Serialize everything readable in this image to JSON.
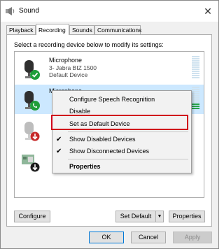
{
  "window": {
    "title": "Sound",
    "close_glyph": "✕"
  },
  "tabs": [
    "Playback",
    "Recording",
    "Sounds",
    "Communications"
  ],
  "instructions": "Select a recording device below to modify its settings:",
  "devices": [
    {
      "name": "Microphone",
      "desc": "3- Jabra BIZ 1500",
      "status": "Default Device",
      "badge": "default-check",
      "level_on": 0
    },
    {
      "name": "Microphone",
      "desc": "",
      "status": "",
      "badge": "communications-phone",
      "level_on": 3
    },
    {
      "name": "",
      "desc": "",
      "status": "",
      "badge": "disabled-arrow",
      "level_on": 0
    },
    {
      "name": "",
      "desc": "",
      "status": "",
      "badge": "disabled-arrow",
      "level_on": 0
    }
  ],
  "context_menu": {
    "items": [
      {
        "label": "Configure Speech Recognition",
        "checked": false,
        "bold": false
      },
      {
        "label": "Disable",
        "checked": false,
        "bold": false
      },
      {
        "label": "Set as Default Device",
        "checked": false,
        "bold": false
      },
      {
        "label": "Show Disabled Devices",
        "checked": true,
        "bold": false
      },
      {
        "label": "Show Disconnected Devices",
        "checked": true,
        "bold": false
      },
      {
        "label": "Properties",
        "checked": false,
        "bold": true
      }
    ],
    "highlighted": "Set as Default Device"
  },
  "buttons": {
    "configure": "Configure",
    "set_default": "Set Default",
    "set_default_arrow": "▼",
    "properties": "Properties",
    "ok": "OK",
    "cancel": "Cancel",
    "apply": "Apply"
  },
  "colors": {
    "selection": "#cce8ff",
    "highlight_box": "#d0021b",
    "badge_green": "#1f9e3a",
    "badge_red": "#c62828",
    "level_on": "#2aa44a"
  }
}
